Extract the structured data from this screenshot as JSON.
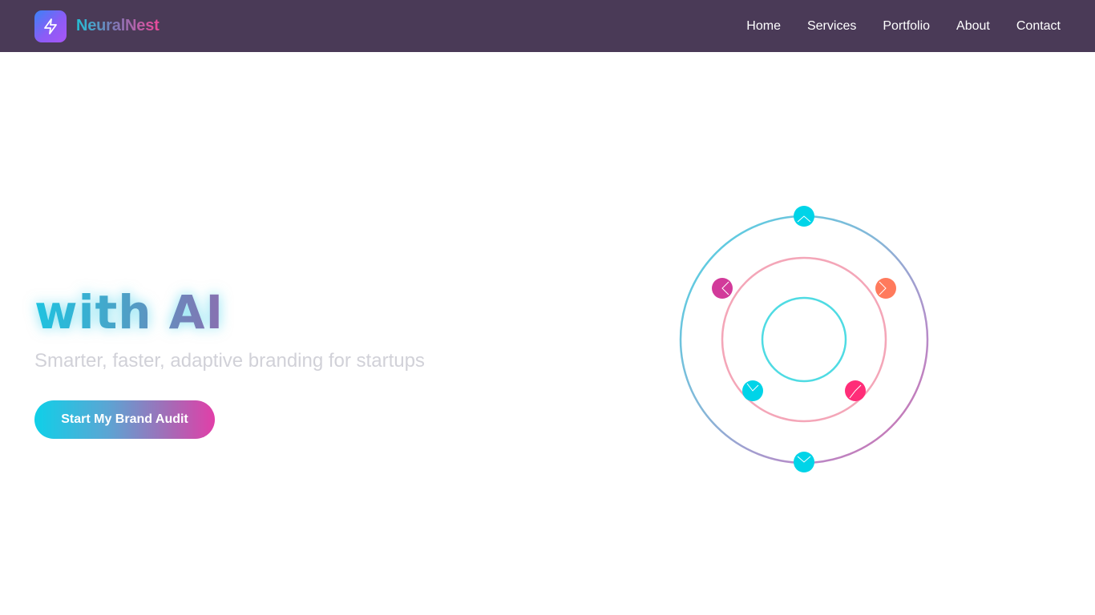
{
  "header": {
    "logo_icon": "lightning-bolt-icon",
    "brand_prefix": "Neural",
    "brand_suffix": "Nest",
    "nav": [
      {
        "label": "Home"
      },
      {
        "label": "Services"
      },
      {
        "label": "Portfolio"
      },
      {
        "label": "About"
      },
      {
        "label": "Contact"
      }
    ]
  },
  "hero": {
    "title": "with AI",
    "subtitle": "Smarter, faster, adaptive branding for startups",
    "cta_label": "Start My Brand Audit"
  },
  "colors": {
    "navbar_bg": "#4a3a57",
    "cyan": "#00d4e8",
    "magenta": "#d23a9a",
    "coral": "#ff7a5c",
    "pink": "#ff2d78",
    "subtitle": "#d1d1d8"
  }
}
